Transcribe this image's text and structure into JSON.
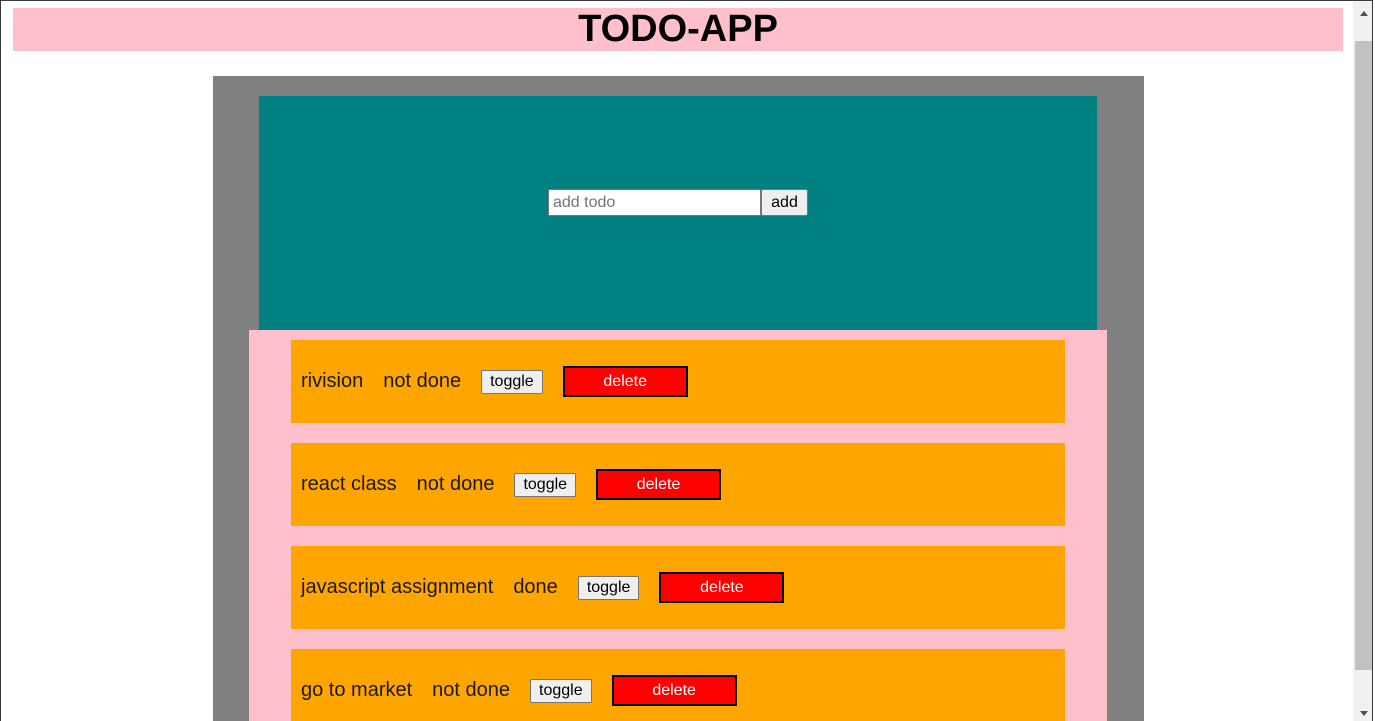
{
  "header": {
    "title": "TODO-APP"
  },
  "form": {
    "placeholder": "add todo",
    "value": "",
    "add_label": "add"
  },
  "todos": [
    {
      "task": "rivision",
      "status": "not done",
      "toggle_label": "toggle",
      "delete_label": "delete"
    },
    {
      "task": "react class",
      "status": "not done",
      "toggle_label": "toggle",
      "delete_label": "delete"
    },
    {
      "task": "javascript assignment",
      "status": "done",
      "toggle_label": "toggle",
      "delete_label": "delete"
    },
    {
      "task": "go to market",
      "status": "not done",
      "toggle_label": "toggle",
      "delete_label": "delete"
    }
  ],
  "colors": {
    "header_bg": "#ffc0cb",
    "outer_bg": "#808080",
    "input_panel_bg": "#008080",
    "list_bg": "#ffc0cb",
    "item_bg": "#ffa500",
    "delete_bg": "#ff0000"
  },
  "icons": {
    "scroll_up": "triangle-up-icon",
    "scroll_down": "triangle-down-icon"
  }
}
